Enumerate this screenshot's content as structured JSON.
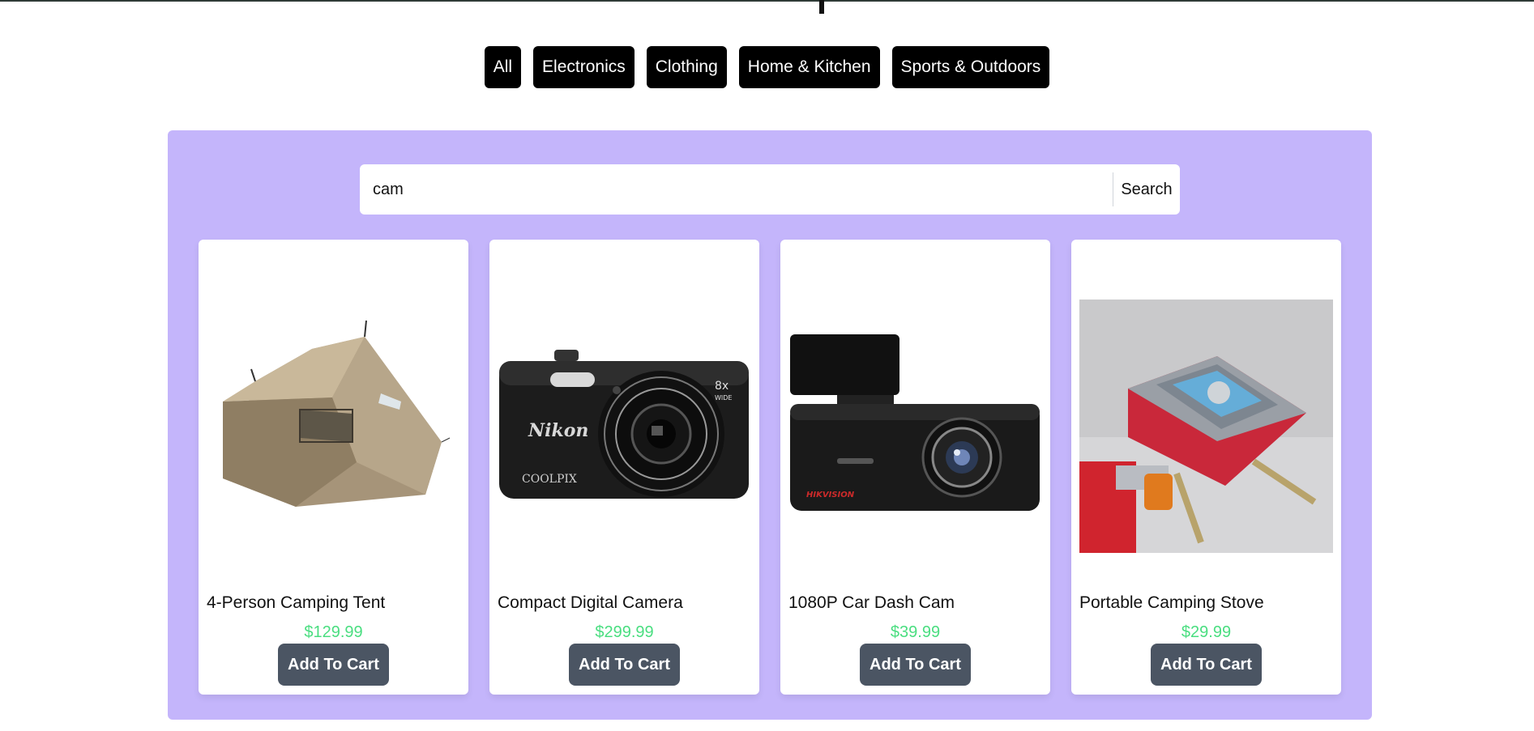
{
  "categories": [
    "All",
    "Electronics",
    "Clothing",
    "Home & Kitchen",
    "Sports & Outdoors"
  ],
  "search": {
    "value": "cam",
    "button_label": "Search"
  },
  "products": [
    {
      "name": "4-Person Camping Tent",
      "price": "$129.99",
      "button_label": "Add To Cart",
      "image": "tent-image"
    },
    {
      "name": "Compact Digital Camera",
      "price": "$299.99",
      "button_label": "Add To Cart",
      "image": "camera-image",
      "image_text": [
        "Nikon",
        "COOLPIX",
        "8x",
        "WIDE"
      ]
    },
    {
      "name": "1080P Car Dash Cam",
      "price": "$39.99",
      "button_label": "Add To Cart",
      "image": "dash-cam-image",
      "image_text": [
        "HIKVISION"
      ]
    },
    {
      "name": "Portable Camping Stove",
      "price": "$29.99",
      "button_label": "Add To Cart",
      "image": "camping-stove-image"
    }
  ],
  "colors": {
    "panel": "#c4b5fb",
    "category_button": "#000000",
    "cart_button": "#4b5563",
    "price": "#4ade80"
  }
}
